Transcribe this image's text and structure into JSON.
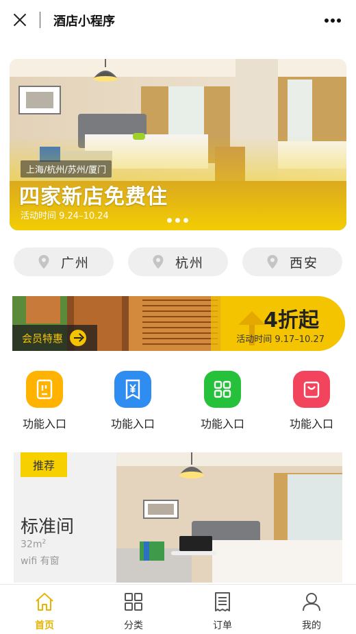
{
  "header": {
    "title": "酒店小程序",
    "close_icon": "close-icon",
    "more_icon": "more-dots-icon"
  },
  "hero": {
    "cities": "上海/杭州/苏州/厦门",
    "headline": "四家新店免费住",
    "dates": "活动时间 9.24–10.24",
    "slide_count": 3,
    "accent": "#f5d000"
  },
  "city_filter": [
    {
      "name": "广州",
      "icon": "location-pin-icon"
    },
    {
      "name": "杭州",
      "icon": "location-pin-icon"
    },
    {
      "name": "西安",
      "icon": "location-pin-icon"
    }
  ],
  "member_banner": {
    "tag": "会员特惠",
    "discount": "4折起",
    "dates": "活动时间 9.17–10.27",
    "arrow_icon": "arrow-right-icon"
  },
  "features": [
    {
      "label": "功能入口",
      "icon": "phone-card-icon",
      "color": "#ffb300"
    },
    {
      "label": "功能入口",
      "icon": "yen-receipt-icon",
      "color": "#2f8cf0"
    },
    {
      "label": "功能入口",
      "icon": "grid-apps-icon",
      "color": "#25c13a"
    },
    {
      "label": "功能入口",
      "icon": "shopping-bag-icon",
      "color": "#f2445c"
    }
  ],
  "recommend": {
    "badge": "推荐",
    "room_name": "标准间",
    "size_value": "32m",
    "size_unit": "2",
    "amenities": "wifi 有窗"
  },
  "tabbar": {
    "active_color": "#e9b400",
    "items": [
      {
        "label": "首页",
        "icon": "home-icon",
        "active": true
      },
      {
        "label": "分类",
        "icon": "category-grid-icon",
        "active": false
      },
      {
        "label": "订单",
        "icon": "order-receipt-icon",
        "active": false
      },
      {
        "label": "我的",
        "icon": "user-profile-icon",
        "active": false
      }
    ]
  }
}
